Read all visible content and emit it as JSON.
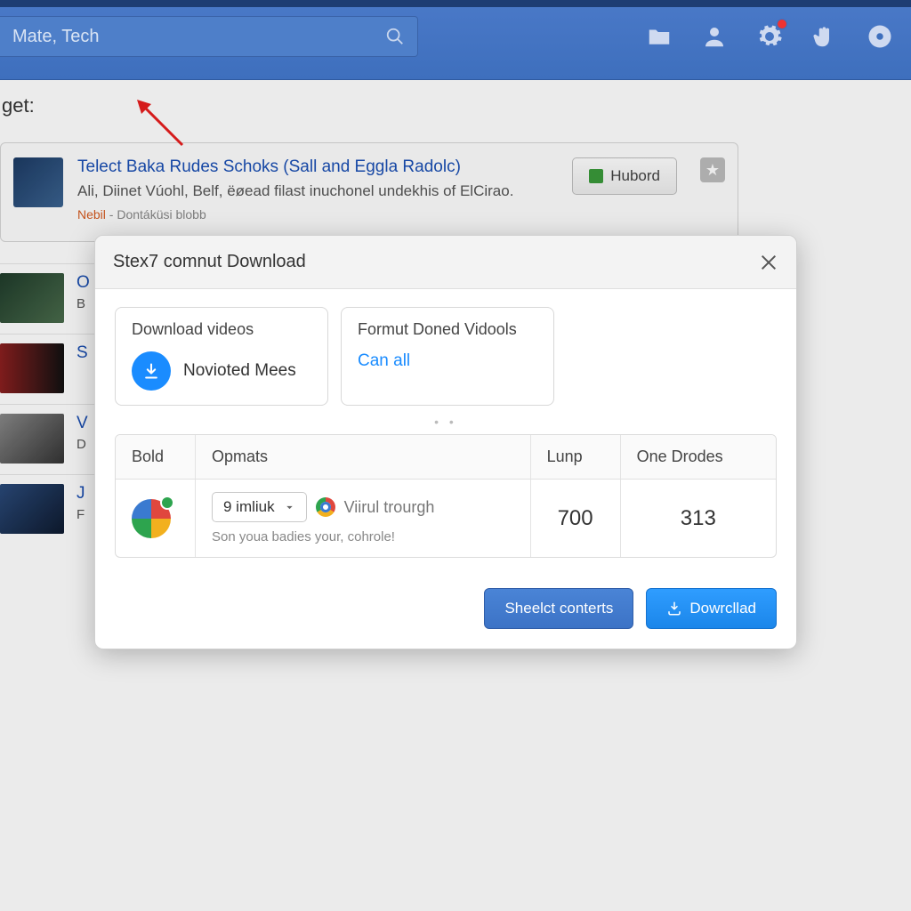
{
  "header": {
    "search_value": "Mate, Tech",
    "icons": [
      "folder-icon",
      "user-icon",
      "gear-icon",
      "grab-icon",
      "disc-icon"
    ],
    "gear_has_badge": true
  },
  "page": {
    "section_label": "get:"
  },
  "featured": {
    "title": "Telect Baka Rudes Schoks (Sall and Eggla Radolc)",
    "subtitle": "Ali, Diinet Vúohl, Belf, ëøead filast inuchonel undekhis of ElCirao.",
    "meta1": "Nebil",
    "meta2": " - Dontáküsi blobb",
    "button": "Hubord"
  },
  "rows": [
    {
      "title": "O",
      "sub": "B"
    },
    {
      "title": "S",
      "sub": ""
    },
    {
      "title": "V",
      "sub": "D"
    },
    {
      "title": "J",
      "sub": "F"
    }
  ],
  "modal": {
    "title": "Stex7 comnut Download",
    "opt1": {
      "label": "Download videos",
      "action": "Novioted Mees"
    },
    "opt2": {
      "label": "Formut Doned Vidools",
      "action": "Can all"
    },
    "table": {
      "headers": [
        "Bold",
        "Opmats",
        "Lunp",
        "One Drodes"
      ],
      "row": {
        "select_value": "9 imliuk",
        "browser_text": "Viirul trourgh",
        "note": "Son youa badies your, cohrole!",
        "col3": "700",
        "col4": "313"
      }
    },
    "footer": {
      "select_btn": "Sheelct conterts",
      "download_btn": "Dowrcllad"
    }
  }
}
